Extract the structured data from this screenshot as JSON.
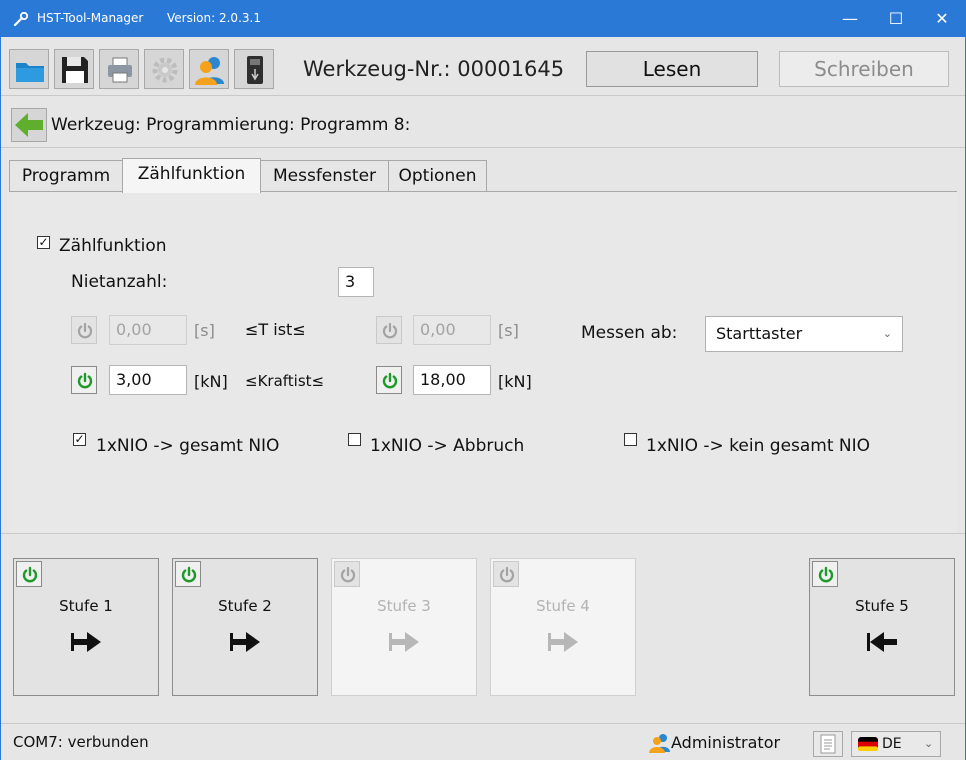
{
  "window": {
    "title": "HST-Tool-Manager",
    "version": "Version: 2.0.3.1",
    "min_glyph": "—",
    "max_glyph": "☐",
    "close_glyph": "✕"
  },
  "toolbar": {
    "buttons": [
      "folder-open-icon",
      "save-icon",
      "print-icon",
      "settings-gear-icon",
      "user-icon",
      "usb-device-icon"
    ],
    "tool_number": "Werkzeug-Nr.: 00001645",
    "read_label": "Lesen",
    "write_label": "Schreiben"
  },
  "breadcrumb": {
    "text": "Werkzeug: Programmierung: Programm 8:"
  },
  "tabs": [
    "Programm",
    "Zählfunktion",
    "Messfenster",
    "Optionen"
  ],
  "active_tab": "Zählfunktion",
  "count_function": {
    "enabled_label": "Zählfunktion",
    "enabled": true,
    "rivet_count_label": "Nietanzahl:",
    "rivet_count": "3",
    "time_min": "0,00",
    "time_max": "0,00",
    "time_unit": "[s]",
    "time_label": "≤T ist≤",
    "force_min": "3,00",
    "force_max": "18,00",
    "force_unit": "[kN]",
    "force_label": "≤Kraftist≤",
    "measure_from_label": "Messen ab:",
    "measure_from_value": "Starttaster",
    "options": [
      {
        "label": "1xNIO -> gesamt NIO",
        "checked": true
      },
      {
        "label": "1xNIO -> Abbruch",
        "checked": false
      },
      {
        "label": "1xNIO -> kein gesamt NIO",
        "checked": false
      }
    ]
  },
  "stages": [
    {
      "label": "Stufe 1",
      "enabled": true,
      "direction": "right"
    },
    {
      "label": "Stufe 2",
      "enabled": true,
      "direction": "right"
    },
    {
      "label": "Stufe 3",
      "enabled": false,
      "direction": "right"
    },
    {
      "label": "Stufe 4",
      "enabled": false,
      "direction": "right"
    },
    {
      "label": "Stufe 5",
      "enabled": true,
      "direction": "left"
    }
  ],
  "status": {
    "connection": "COM7: verbunden",
    "user": "Administrator",
    "language": "DE"
  },
  "colors": {
    "titlebar": "#2b79d6",
    "power_on": "#1f9a2a",
    "power_off": "#a3a3a3",
    "back_arrow": "#5fae2e"
  }
}
